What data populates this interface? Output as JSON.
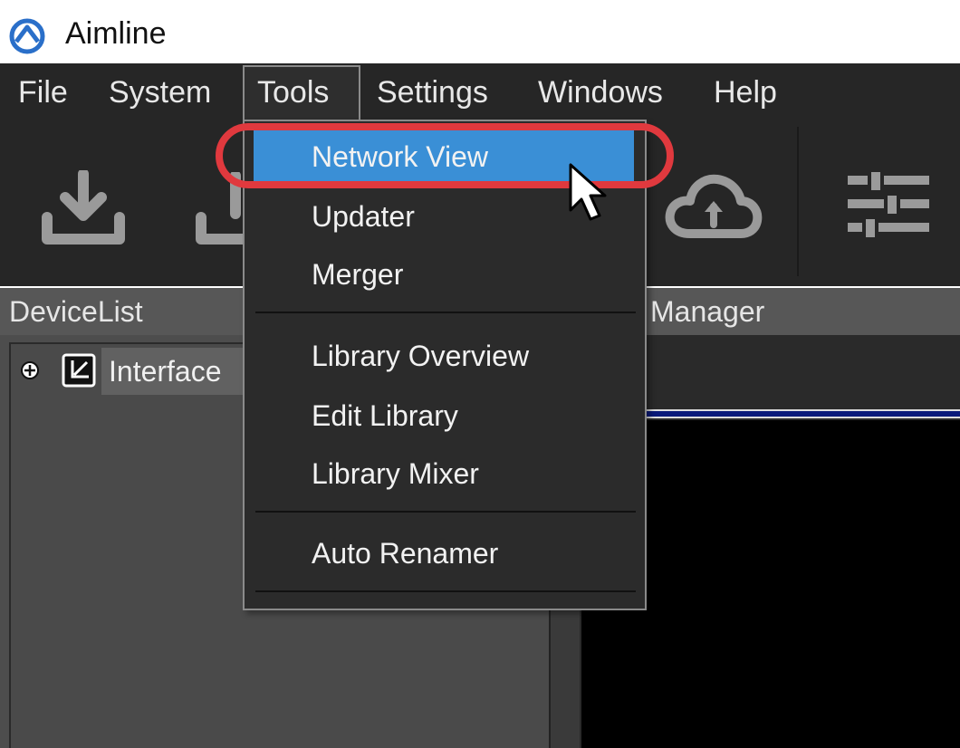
{
  "window": {
    "title": "Aimline"
  },
  "menubar": {
    "items": [
      {
        "label": "File"
      },
      {
        "label": "System"
      },
      {
        "label": "Tools"
      },
      {
        "label": "Settings"
      },
      {
        "label": "Windows"
      },
      {
        "label": "Help"
      }
    ],
    "open_menu": "Tools"
  },
  "toolbar": {
    "buttons": [
      {
        "icon": "download-icon"
      },
      {
        "icon": "upload-icon"
      },
      {
        "icon": "cloud-upload-icon"
      },
      {
        "icon": "sliders-icon"
      }
    ]
  },
  "panels": {
    "left_header": "DeviceList",
    "right_header": "Manager"
  },
  "device_tree": {
    "items": [
      {
        "label": "Interface"
      }
    ]
  },
  "tools_menu": {
    "items": [
      {
        "label": "Network View",
        "highlighted": true
      },
      {
        "label": "Updater"
      },
      {
        "label": "Merger"
      },
      {
        "label": "Library Overview"
      },
      {
        "label": "Edit Library"
      },
      {
        "label": "Library Mixer"
      },
      {
        "label": "Auto Renamer"
      }
    ]
  },
  "colors": {
    "highlight": "#3a8fd6",
    "annotation_ring": "#e0393e",
    "menubar_bg": "#262626"
  }
}
